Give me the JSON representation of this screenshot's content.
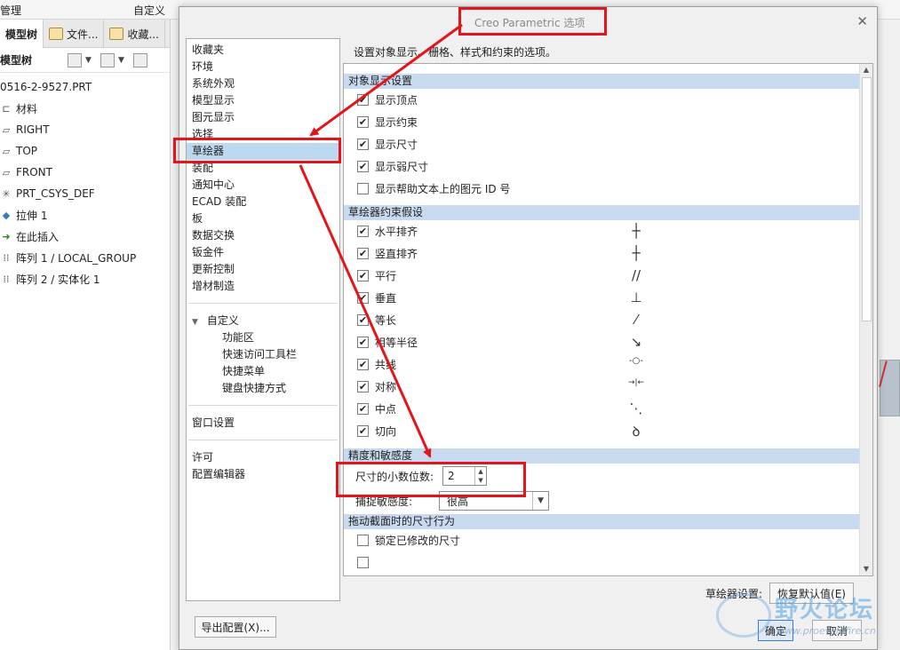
{
  "background_app": {
    "top_left_label": "管理",
    "top_menu_label": "自定义",
    "tabs": [
      {
        "label": "模型树"
      },
      {
        "label": "文件..."
      },
      {
        "label": "收藏..."
      }
    ],
    "tree_toolbar_label": "模型树",
    "tree": [
      {
        "label": "0516-2-9527.PRT",
        "icon": ""
      },
      {
        "label": "材料",
        "icon": "material-icon"
      },
      {
        "label": "RIGHT",
        "icon": "datum-plane-icon"
      },
      {
        "label": "TOP",
        "icon": "datum-plane-icon"
      },
      {
        "label": "FRONT",
        "icon": "datum-plane-icon"
      },
      {
        "label": "PRT_CSYS_DEF",
        "icon": "csys-icon"
      },
      {
        "label": "拉伸 1",
        "icon": "extrude-icon"
      },
      {
        "label": "在此插入",
        "icon": "insert-arrow-icon"
      },
      {
        "label": "阵列 1 / LOCAL_GROUP",
        "icon": "pattern-icon"
      },
      {
        "label": "阵列 2 / 实体化 1",
        "icon": "pattern-icon"
      }
    ]
  },
  "dialog": {
    "title": "Creo Parametric 选项",
    "description": "设置对象显示、栅格、样式和约束的选项。",
    "categories_group1": [
      "收藏夹",
      "环境",
      "系统外观",
      "模型显示",
      "图元显示",
      "选择",
      "草绘器",
      "装配",
      "通知中心",
      "ECAD 装配",
      "板",
      "数据交换",
      "钣金件",
      "更新控制",
      "增材制造"
    ],
    "selected_category": "草绘器",
    "customize": {
      "label": "自定义",
      "items": [
        "功能区",
        "快速访问工具栏",
        "快捷菜单",
        "键盘快捷方式"
      ]
    },
    "window_settings": "窗口设置",
    "categories_group3": [
      "许可",
      "配置编辑器"
    ],
    "sections": {
      "object_display": {
        "title": "对象显示设置",
        "options": [
          {
            "label": "显示顶点",
            "checked": true
          },
          {
            "label": "显示约束",
            "checked": true
          },
          {
            "label": "显示尺寸",
            "checked": true
          },
          {
            "label": "显示弱尺寸",
            "checked": true
          },
          {
            "label": "显示帮助文本上的图元 ID 号",
            "checked": false
          }
        ]
      },
      "constraints": {
        "title": "草绘器约束假设",
        "options": [
          {
            "label": "水平排齐",
            "checked": true,
            "symbol": "┼"
          },
          {
            "label": "竖直排齐",
            "checked": true,
            "symbol": "┼"
          },
          {
            "label": "平行",
            "checked": true,
            "symbol": "//"
          },
          {
            "label": "垂直",
            "checked": true,
            "symbol": "⊥"
          },
          {
            "label": "等长",
            "checked": true,
            "symbol": "⁄"
          },
          {
            "label": "相等半径",
            "checked": true,
            "symbol": "↘"
          },
          {
            "label": "共线",
            "checked": true,
            "symbol": "-○-"
          },
          {
            "label": "对称",
            "checked": true,
            "symbol": "→|←"
          },
          {
            "label": "中点",
            "checked": true,
            "symbol": "⋱"
          },
          {
            "label": "切向",
            "checked": true,
            "symbol": "ꝺ"
          }
        ]
      },
      "precision": {
        "title": "精度和敏感度",
        "decimal_label": "尺寸的小数位数:",
        "decimal_value": "2",
        "snap_label": "捕捉敏感度:",
        "snap_value": "很高"
      },
      "drag_section": {
        "title": "拖动截面时的尺寸行为",
        "options": [
          {
            "label": "锁定已修改的尺寸",
            "checked": false
          }
        ]
      }
    },
    "sketcher_settings_label": "草绘器设置:",
    "restore_defaults_button": "恢复默认值(E)",
    "export_button": "导出配置(X)...",
    "ok_button": "确定",
    "cancel_button": "取消"
  },
  "watermark": {
    "text": "野火论坛",
    "url": "www.proewildfire.cn"
  },
  "colors": {
    "annotation_red": "#e4141a",
    "section_header_blue": "#c8daf0",
    "selected_row_blue": "#bcd9f0"
  }
}
